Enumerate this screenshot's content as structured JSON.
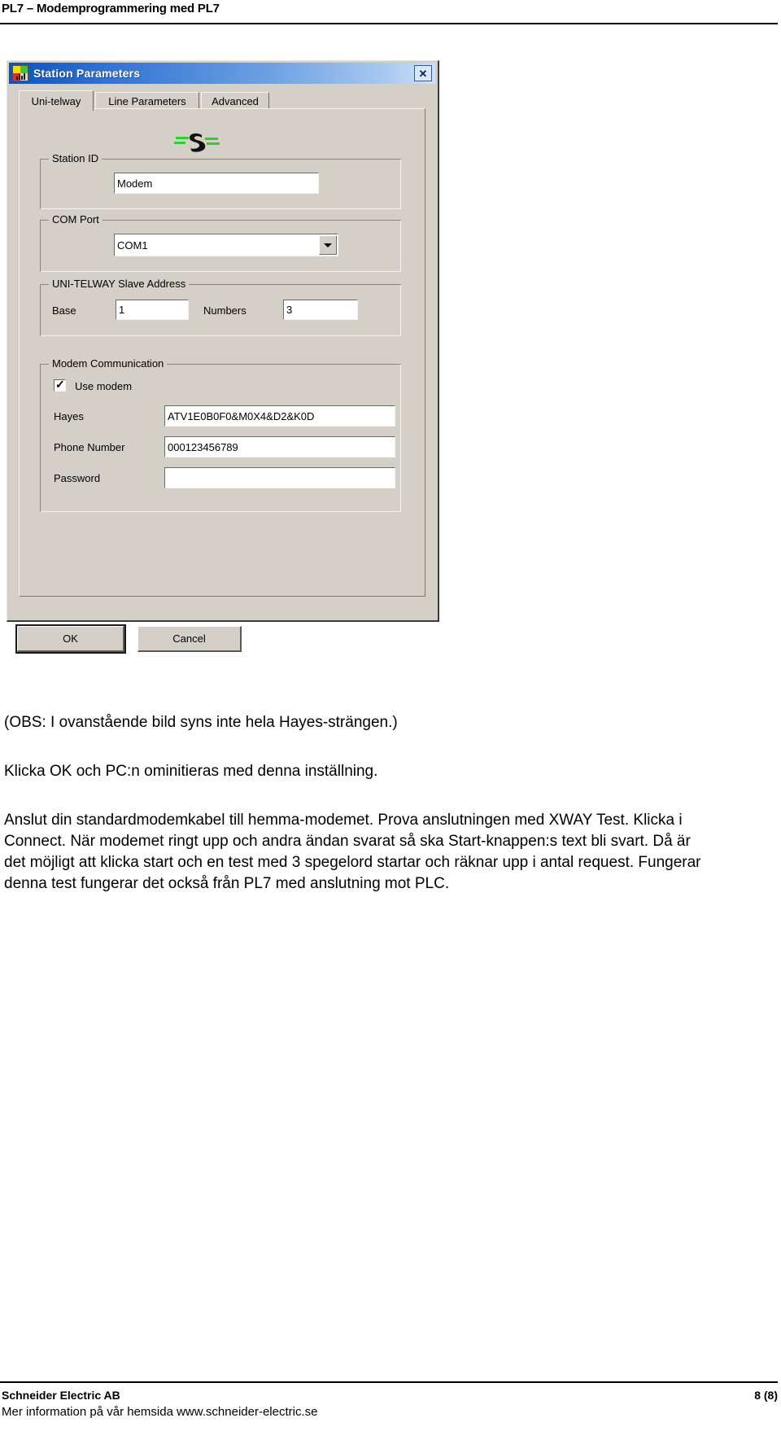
{
  "document": {
    "header_title": "PL7 – Modemprogrammering med PL7",
    "footer": {
      "company": "Schneider Electric AB",
      "website_line": "Mer information på vår hemsida www.schneider-electric.se",
      "page_number": "8 (8)"
    }
  },
  "dialog": {
    "title": "Station Parameters",
    "close_label": "✕",
    "tabs": [
      {
        "label": "Uni-telway",
        "active": true
      },
      {
        "label": "Line Parameters",
        "active": false
      },
      {
        "label": "Advanced",
        "active": false
      }
    ],
    "groups": {
      "station_id": {
        "label": "Station ID",
        "value": "Modem"
      },
      "com_port": {
        "label": "COM Port",
        "value": "COM1",
        "options": [
          "COM1"
        ]
      },
      "slave_address": {
        "label": "UNI-TELWAY Slave Address",
        "base_label": "Base",
        "base_value": "1",
        "numbers_label": "Numbers",
        "numbers_value": "3"
      },
      "modem_communication": {
        "label": "Modem Communication",
        "use_modem_label": "Use modem",
        "use_modem_checked": true,
        "hayes_label": "Hayes",
        "hayes_value": "ATV1E0B0F0&M0X4&D2&K0D",
        "phone_label": "Phone Number",
        "phone_value": "000123456789",
        "password_label": "Password",
        "password_value": ""
      }
    },
    "buttons": {
      "ok": "OK",
      "cancel": "Cancel"
    }
  },
  "body": {
    "note": "(OBS: I ovanstående bild syns inte hela Hayes-strängen.)",
    "paragraph_1": "Klicka OK och PC:n ominitieras med denna inställning.",
    "paragraph_2": "Anslut din standardmodemkabel till hemma-modemet. Prova anslutningen med XWAY Test. Klicka i Connect. När modemet ringt upp och andra ändan svarat så ska Start-knappen:s text bli svart. Då är det möjligt att klicka start och en test med 3 spegelord startar och räknar upp i antal request. Fungerar denna test fungerar det också från PL7 med anslutning mot PLC."
  },
  "colors": {
    "titlebar_blue": "#2f72d0",
    "dialog_face": "#d4d0c8",
    "logo_green": "#33cc33"
  }
}
